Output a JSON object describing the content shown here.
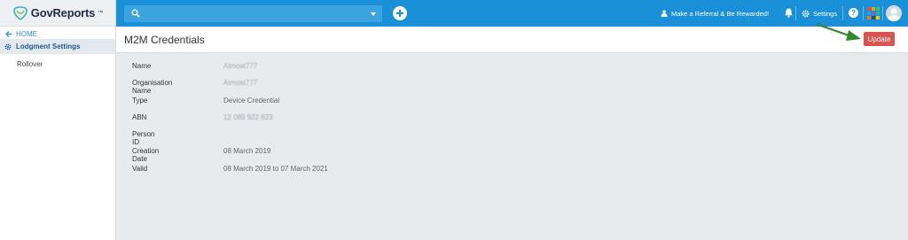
{
  "brand": {
    "name": "GovReports",
    "tm": "™"
  },
  "sidebar": {
    "home_label": "HOME",
    "section_label": "Lodgment Settings",
    "items": [
      {
        "label": "Rollover"
      }
    ]
  },
  "topbar": {
    "search_placeholder": "",
    "referral_label": "Make a Referral & Be Rewarded!",
    "settings_label": "Settings",
    "help_label": "?"
  },
  "page": {
    "title": "M2M Credentials",
    "update_label": "Update"
  },
  "details": [
    {
      "label": "Name",
      "value": "Atmost777",
      "blurred": true
    },
    {
      "label": "Organisation Name",
      "value": "Atmost777",
      "blurred": true
    },
    {
      "label": "Type",
      "value": "Device Credential",
      "blurred": false
    },
    {
      "label": "ABN",
      "value": "12 089 922 823",
      "blurred": true
    },
    {
      "label": "Person ID",
      "value": "",
      "blurred": false
    },
    {
      "label": "Creation Date",
      "value": "08 March 2019",
      "blurred": false
    },
    {
      "label": "Valid",
      "value": "08 March 2019 to 07 March 2021",
      "blurred": false
    }
  ],
  "colors": {
    "topbar": "#1a90d8",
    "update_button": "#d9534f",
    "arrow": "#2e8b2e",
    "apps_grid": [
      "#e74c3c",
      "#f39c12",
      "#2ecc71",
      "#3498db",
      "#9b59b6",
      "#1abc9c",
      "#e67e22",
      "#34495e",
      "#f1c40f"
    ]
  },
  "icons": {
    "logo": "shield-logo-icon",
    "home": "arrow-left-icon",
    "section": "gear-icon",
    "search": "search-icon",
    "add": "plus-circle-icon",
    "referral": "user-icon",
    "notifications": "bell-icon",
    "settings": "gear-icon",
    "help": "question-circle-icon",
    "apps": "apps-grid-icon",
    "avatar": "avatar-icon",
    "annotation": "green-arrow-icon"
  }
}
